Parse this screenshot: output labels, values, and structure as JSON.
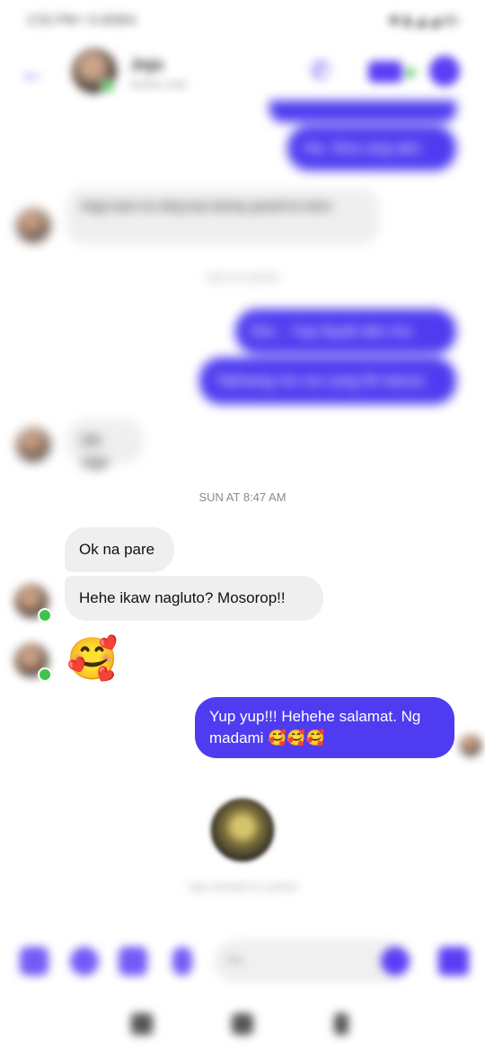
{
  "status_bar": {
    "time": "2:52 PM  •  5.0KB/s",
    "right": "✱  ▮ ◢ ◢ 80"
  },
  "header": {
    "back_icon": "back-arrow-icon",
    "name": "Jojo",
    "subtitle": "Active now"
  },
  "messages_blurred": {
    "sent_1": "Ha. Sino ang ako",
    "recv_1": "Nagi-isaw mo ding kay kamay gosell ko lamn",
    "time_1": "SAT AT 5:28 PM",
    "sent_2": "Eto... Yup ibyalt ako mo",
    "sent_3": "Tatinang mo na Lang 0h kanus",
    "recv_2": "Oh sige"
  },
  "timestamp_main": "SUN AT 8:47 AM",
  "messages": {
    "recv_ok": "Ok na pare",
    "recv_hehe": "Hehe ikaw nagluto? Mosorop!!",
    "recv_emoji": "🥰",
    "sent_yup": "Yup yup!!! Hehehe salamat. Ng madami 🥰🥰🥰"
  },
  "attachment": {
    "caption": "Jojo reacted to a photo"
  },
  "composer": {
    "placeholder": "Aa"
  },
  "colors": {
    "accent": "#4f3cf0",
    "online": "#3fc44a",
    "bubble_received": "#efefef"
  }
}
